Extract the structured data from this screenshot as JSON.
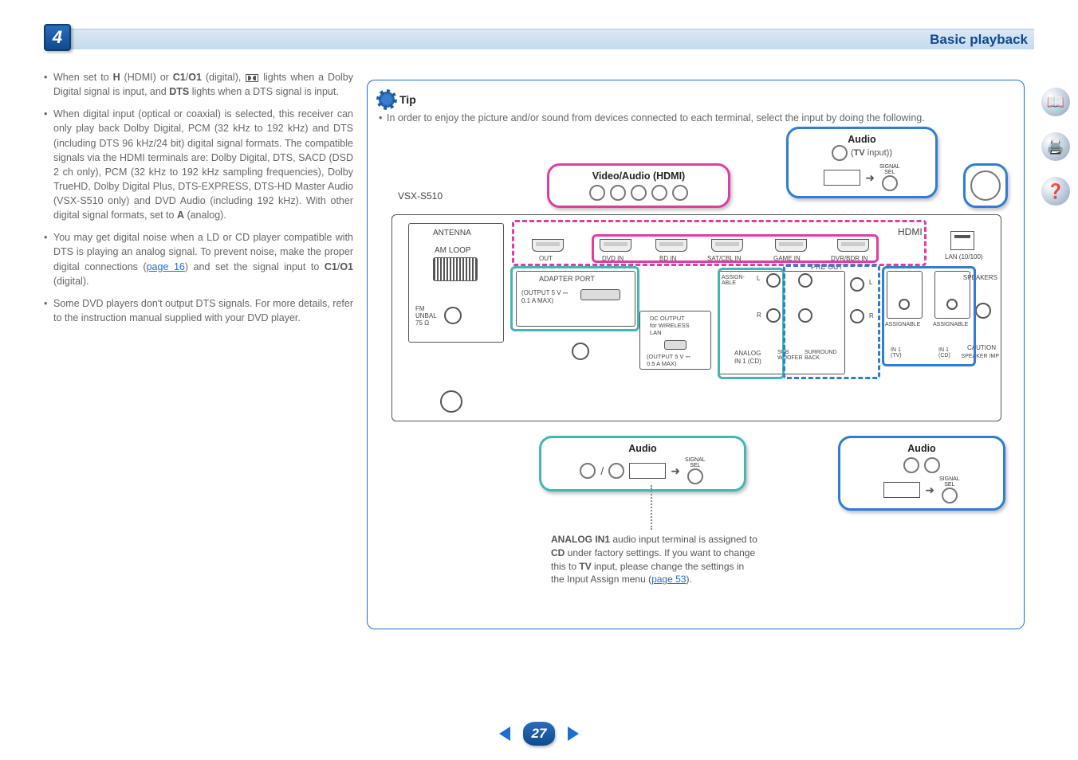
{
  "chapter": {
    "number": "4",
    "title": "Basic playback"
  },
  "page_number": "27",
  "side_icons": [
    "book-icon",
    "printer-icon",
    "help-icon"
  ],
  "left_bullets": {
    "b1_pre": "When set to ",
    "b1_H": "H",
    "b1_mid1": " (HDMI) or ",
    "b1_C1O1": "C1",
    "b1_slash": "/",
    "b1_O1": "O1",
    "b1_mid2": " (digital), ",
    "b1_mid3": " lights when a Dolby Digital signal is input, and ",
    "b1_DTS": "DTS",
    "b1_tail": " lights when a DTS signal is input.",
    "b2_pre": "When digital input (optical or coaxial) is selected, this receiver can only play back Dolby Digital, PCM (32 kHz to 192 kHz) and DTS (including DTS 96 kHz/24 bit) digital signal formats. The compatible signals via the HDMI terminals are: Dolby Digital, DTS, SACD (DSD 2 ch only), PCM (32 kHz to 192 kHz sampling frequencies), Dolby TrueHD, Dolby Digital Plus, DTS-EXPRESS, DTS-HD Master Audio (VSX-S510 only) and DVD Audio (including 192 kHz). With other digital signal formats, set to ",
    "b2_A": "A",
    "b2_tail": " (analog).",
    "b3_pre": "You may get digital noise when a LD or CD player compatible with DTS is playing an analog signal. To prevent noise, make the proper digital connections (",
    "b3_link": "page 16",
    "b3_mid": ") and set the signal input to ",
    "b3_C1": "C1",
    "b3_slash": "/",
    "b3_O1": "O1",
    "b3_tail": " (digital).",
    "b4": "Some DVD players don't output DTS signals. For more details, refer to the instruction manual supplied with your DVD player."
  },
  "tip": {
    "heading": "Tip",
    "body": "In order to enjoy the picture and/or sound from devices connected to each terminal, select the input by doing the following."
  },
  "callouts": {
    "video_audio_hdmi": "Video/Audio (HDMI)",
    "audio_top_title": "Audio",
    "audio_top_sub_pre": "(",
    "audio_top_sub_bold": "TV",
    "audio_top_sub_post": " input)",
    "audio_left_title": "Audio",
    "audio_right_title": "Audio",
    "signal_sel": "SIGNAL\nSEL"
  },
  "panel": {
    "model": "VSX-S510",
    "antenna": "ANTENNA",
    "amloop": "AM LOOP",
    "fm": "FM\nUNBAL\n75 Ω",
    "out": "OUT",
    "dvd": "DVD IN",
    "bd": "BD IN",
    "sat": "SAT/CBL IN",
    "game": "GAME IN",
    "dvr": "DVR/BDR IN",
    "hdmi": "HDMI",
    "lan": "LAN (10/100)",
    "adapter": "ADAPTER PORT",
    "adapter_sub1": "(OUTPUT 5 V ⎓",
    "adapter_sub2": "0.1 A MAX)",
    "dc_out": "DC OUTPUT\nfor WIRELESS\nLAN",
    "dc_out_sub1": "(OUTPUT 5 V ⎓",
    "dc_out_sub2": "0.5 A MAX)",
    "preout": "PRE OUT",
    "assignable": "ASSIGN-\nABLE",
    "assignable2": "ASSIGNABLE",
    "analog": "ANALOG",
    "in1cd": "IN 1 (CD)",
    "sub": "SUB\nWOOFER",
    "surround": "SURROUND\nBACK",
    "l": "L",
    "r": "R",
    "intv": "IN 1\n(TV)",
    "incd": "IN 1\n(CD)",
    "speakers": "SPEAKERS",
    "caution": "CAUTION",
    "speaker_imp": "SPEAKER IMP"
  },
  "note": {
    "pre": "ANALOG IN1",
    "t1": " audio input terminal is assigned to ",
    "cd": "CD",
    "t2": " under factory settings. If you want to change this to ",
    "tv": "TV",
    "t3": " input, please change the settings in the Input Assign menu (",
    "link": "page 53",
    "t4": ")."
  }
}
